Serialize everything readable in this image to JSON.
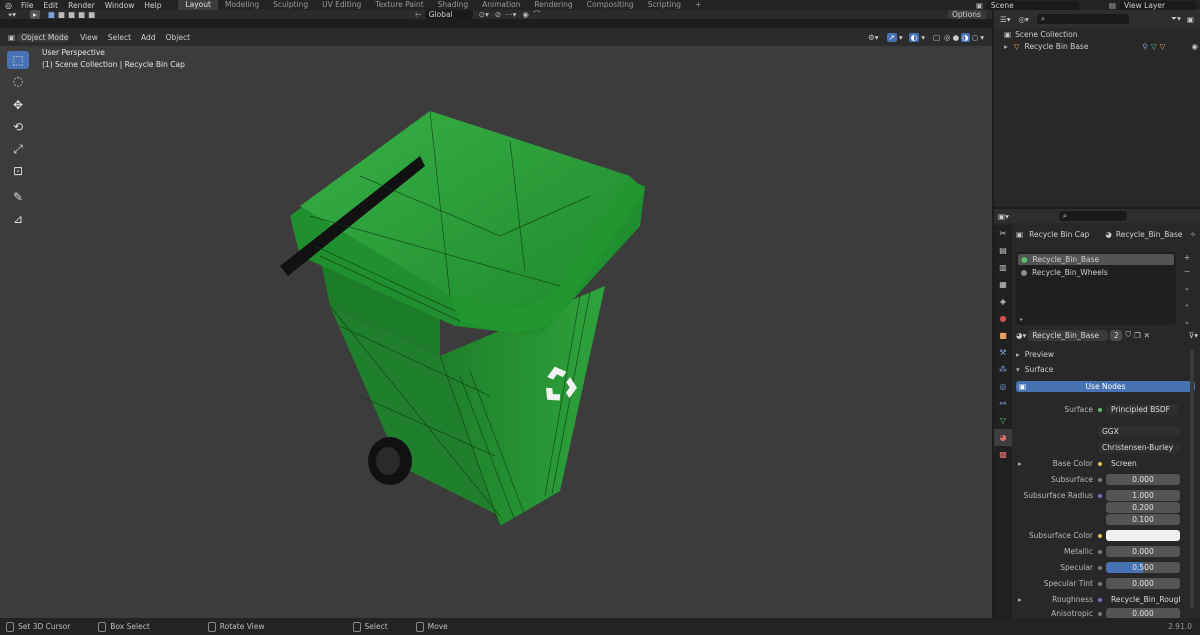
{
  "topbar": {
    "menus": [
      "File",
      "Edit",
      "Render",
      "Window",
      "Help"
    ],
    "workspaces": [
      "Layout",
      "Modeling",
      "Sculpting",
      "UV Editing",
      "Texture Paint",
      "Shading",
      "Animation",
      "Rendering",
      "Compositing",
      "Scripting"
    ],
    "active_workspace": "Layout",
    "add_workspace": "+",
    "scene": "Scene",
    "view_layer": "View Layer"
  },
  "viewport": {
    "transform_orientation": "Global",
    "options_label": "Options",
    "mode": "Object Mode",
    "menu": [
      "View",
      "Select",
      "Add",
      "Object"
    ],
    "perspective_label": "User Perspective",
    "context_label": "(1) Scene Collection | Recycle Bin Cap",
    "tools": [
      "select-box-icon",
      "cursor-icon",
      "move-icon",
      "rotate-icon",
      "scale-icon",
      "transform-icon",
      "annotate-icon",
      "measure-icon"
    ]
  },
  "outliner": {
    "root": "Scene Collection",
    "object": "Recycle Bin Base"
  },
  "properties": {
    "object_name": "Recycle Bin Cap",
    "material_header": "Recycle_Bin_Base",
    "slots": [
      "Recycle_Bin_Base",
      "Recycle_Bin_Wheels"
    ],
    "material_name": "Recycle_Bin_Base",
    "user_count": "2",
    "preview_label": "Preview",
    "surface_panel": "Surface",
    "use_nodes": "Use Nodes",
    "surface_label": "Surface",
    "surface_shader": "Principled BSDF",
    "distribution": "GGX",
    "subsurface_method": "Christensen-Burley",
    "base_color_label": "Base Color",
    "base_color_value": "Screen",
    "subsurface_label": "Subsurface",
    "subsurface_value": "0.000",
    "subsurface_radius_label": "Subsurface Radius",
    "subsurface_radius": [
      "1.000",
      "0.200",
      "0.100"
    ],
    "subsurface_color_label": "Subsurface Color",
    "metallic_label": "Metallic",
    "metallic_value": "0.000",
    "specular_label": "Specular",
    "specular_value": "0.500",
    "specular_fill": 0.5,
    "specular_tint_label": "Specular Tint",
    "specular_tint_value": "0.000",
    "roughness_label": "Roughness",
    "roughness_value": "Recycle_Bin_Roughness.p...",
    "anisotropic_label": "Anisotropic",
    "anisotropic_value": "0.000"
  },
  "statusbar": {
    "items": [
      "Set 3D Cursor",
      "Box Select",
      "Rotate View",
      "Select",
      "Move"
    ],
    "version": "2.91.0"
  },
  "colors": {
    "accent": "#4772b3",
    "bin_green": "#2e9e3a",
    "viewport_bg": "#3c3c3c"
  }
}
